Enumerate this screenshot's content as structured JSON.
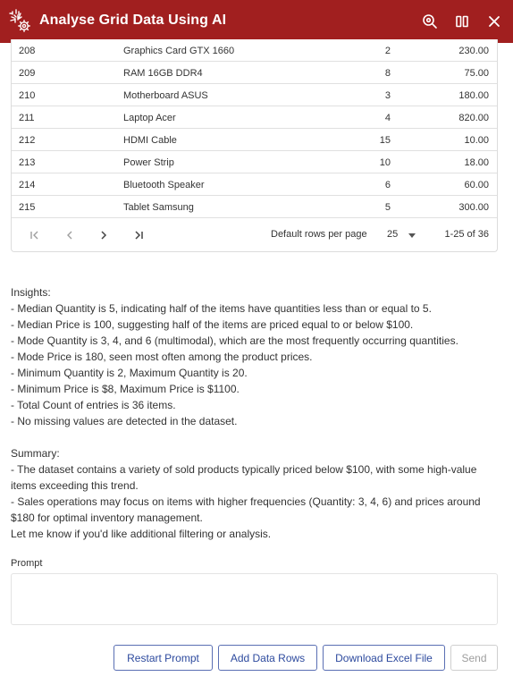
{
  "header": {
    "title": "Analyse Grid Data Using AI",
    "color": "#a11f1f",
    "icons": [
      "ai-brain-logo-icon",
      "zoom-settings-icon",
      "columns-icon",
      "close-icon"
    ]
  },
  "grid": {
    "rows": [
      {
        "id": "208",
        "name": "Graphics Card GTX 1660",
        "qty": "2",
        "price": "230.00"
      },
      {
        "id": "209",
        "name": "RAM 16GB DDR4",
        "qty": "8",
        "price": "75.00"
      },
      {
        "id": "210",
        "name": "Motherboard ASUS",
        "qty": "3",
        "price": "180.00"
      },
      {
        "id": "211",
        "name": "Laptop Acer",
        "qty": "4",
        "price": "820.00"
      },
      {
        "id": "212",
        "name": "HDMI Cable",
        "qty": "15",
        "price": "10.00"
      },
      {
        "id": "213",
        "name": "Power Strip",
        "qty": "10",
        "price": "18.00"
      },
      {
        "id": "214",
        "name": "Bluetooth Speaker",
        "qty": "6",
        "price": "60.00"
      },
      {
        "id": "215",
        "name": "Tablet Samsung",
        "qty": "5",
        "price": "300.00"
      }
    ],
    "pager": {
      "rows_per_page_label": "Default rows per page",
      "rows_per_page_value": "25",
      "range": "1-25 of 36",
      "icons": [
        "first-page-icon",
        "previous-page-icon",
        "next-page-icon",
        "last-page-icon"
      ]
    }
  },
  "insights": {
    "lines": [
      "Insights:",
      "- Median Quantity is 5, indicating half of the items have quantities less than or equal to 5.",
      "- Median Price is 100, suggesting half of the items are priced equal to or below $100.",
      "- Mode Quantity is 3, 4, and 6 (multimodal), which are the most frequently occurring quantities.",
      "- Mode Price is 180, seen most often among the product prices.",
      "- Minimum Quantity is 2, Maximum Quantity is 20.",
      "- Minimum Price is $8, Maximum Price is $1100.",
      "- Total Count of entries is 36 items.",
      "- No missing values are detected in the dataset."
    ],
    "summary_lines": [
      "Summary:",
      "- The dataset contains a variety of sold products typically priced below $100, with some high-value items exceeding this trend.",
      "- Sales operations may focus on items with higher frequencies (Quantity: 3, 4, 6) and prices around $180 for optimal inventory management.",
      "Let me know if you'd like additional filtering or analysis."
    ]
  },
  "prompt": {
    "label": "Prompt",
    "value": ""
  },
  "buttons": {
    "restart": "Restart Prompt",
    "add_rows": "Add Data Rows",
    "download": "Download Excel File",
    "send": "Send"
  }
}
